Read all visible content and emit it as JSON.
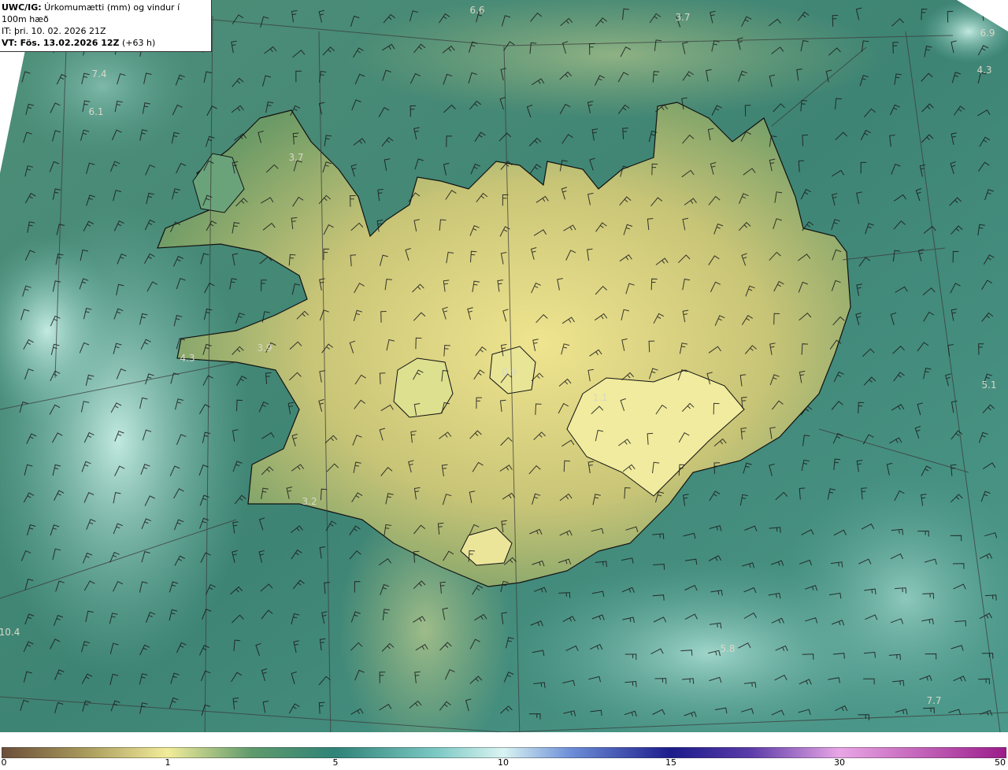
{
  "header": {
    "line1_bold": "UWC/IG:",
    "line1_rest": " Úrkomumætti (mm) og vindur í 100m hæð",
    "line2_bold": "IT:",
    "line2_rest": " þri. 10. 02. 2026 21Z",
    "line3_bold": "VT: Fös. 13.02.2026 12Z",
    "line3_rest": " (+63 h)"
  },
  "map_labels": [
    {
      "text": "6.6"
    },
    {
      "text": "3.7"
    },
    {
      "text": "6.9"
    },
    {
      "text": "4.3"
    },
    {
      "text": "7.4"
    },
    {
      "text": "6.1"
    },
    {
      "text": "3.7"
    },
    {
      "text": "3.9"
    },
    {
      "text": "4.3"
    },
    {
      "text": "5.1"
    },
    {
      "text": "3.2"
    },
    {
      "text": "5.8"
    },
    {
      "text": "7.7"
    },
    {
      "text": "10.4"
    },
    {
      "text": "0.9"
    },
    {
      "text": "1.1"
    }
  ],
  "colorbar": {
    "ticks": [
      "0",
      "1",
      "5",
      "10",
      "15",
      "30",
      "50"
    ],
    "stops": [
      {
        "value": 0,
        "color": "#6b4f3a"
      },
      {
        "value": 0.5,
        "color": "#a89a5c"
      },
      {
        "value": 1,
        "color": "#f2ec9a"
      },
      {
        "value": 3,
        "color": "#5f9a6c"
      },
      {
        "value": 5,
        "color": "#2f8378"
      },
      {
        "value": 8,
        "color": "#7cc8c4"
      },
      {
        "value": 10,
        "color": "#d9f4f2"
      },
      {
        "value": 12,
        "color": "#6d8fd8"
      },
      {
        "value": 15,
        "color": "#1c1c8c"
      },
      {
        "value": 22,
        "color": "#5a3aa8"
      },
      {
        "value": 30,
        "color": "#e9a6e6"
      },
      {
        "value": 50,
        "color": "#9c1e8c"
      }
    ]
  }
}
